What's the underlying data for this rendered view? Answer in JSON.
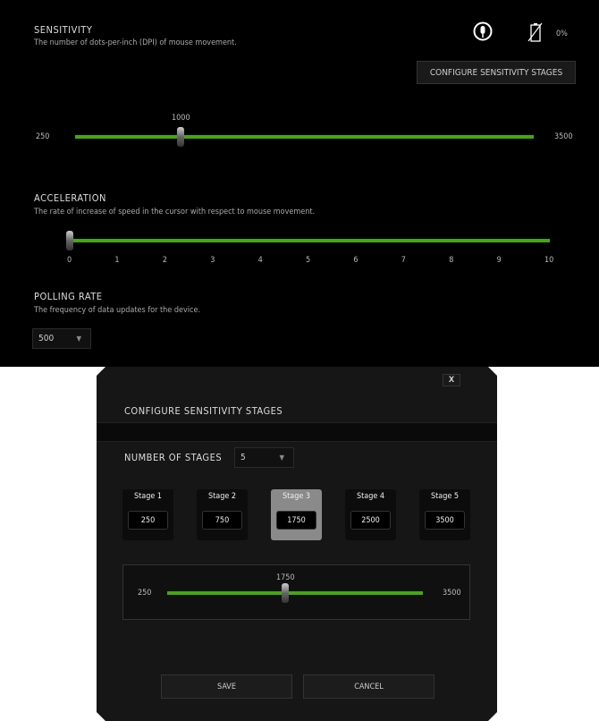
{
  "sensitivity": {
    "title": "SENSITIVITY",
    "desc": "The number of dots-per-inch (DPI) of mouse movement.",
    "min": "250",
    "max": "3500",
    "value": "1000",
    "battery": "0%",
    "configure_label": "CONFIGURE SENSITIVITY STAGES",
    "icons": [
      "mouse-icon",
      "battery-empty-icon"
    ],
    "accent": "#44a80e"
  },
  "acceleration": {
    "title": "ACCELERATION",
    "desc": "The rate of increase of speed in the cursor with respect to mouse movement.",
    "ticks": [
      "0",
      "1",
      "2",
      "3",
      "4",
      "5",
      "6",
      "7",
      "8",
      "9",
      "10"
    ],
    "value": 0
  },
  "polling": {
    "title": "POLLING RATE",
    "desc": "The frequency of data updates for the device.",
    "value": "500"
  },
  "modal": {
    "close": "X",
    "title": "CONFIGURE SENSITIVITY STAGES",
    "stages_label": "NUMBER OF STAGES",
    "stages_value": "5",
    "stages": [
      {
        "label": "Stage 1",
        "value": "250"
      },
      {
        "label": "Stage 2",
        "value": "750"
      },
      {
        "label": "Stage 3",
        "value": "1750"
      },
      {
        "label": "Stage 4",
        "value": "2500"
      },
      {
        "label": "Stage 5",
        "value": "3500"
      }
    ],
    "selected_stage": 3,
    "slider": {
      "min": "250",
      "max": "3500",
      "value": "1750"
    },
    "save": "SAVE",
    "cancel": "CANCEL"
  }
}
